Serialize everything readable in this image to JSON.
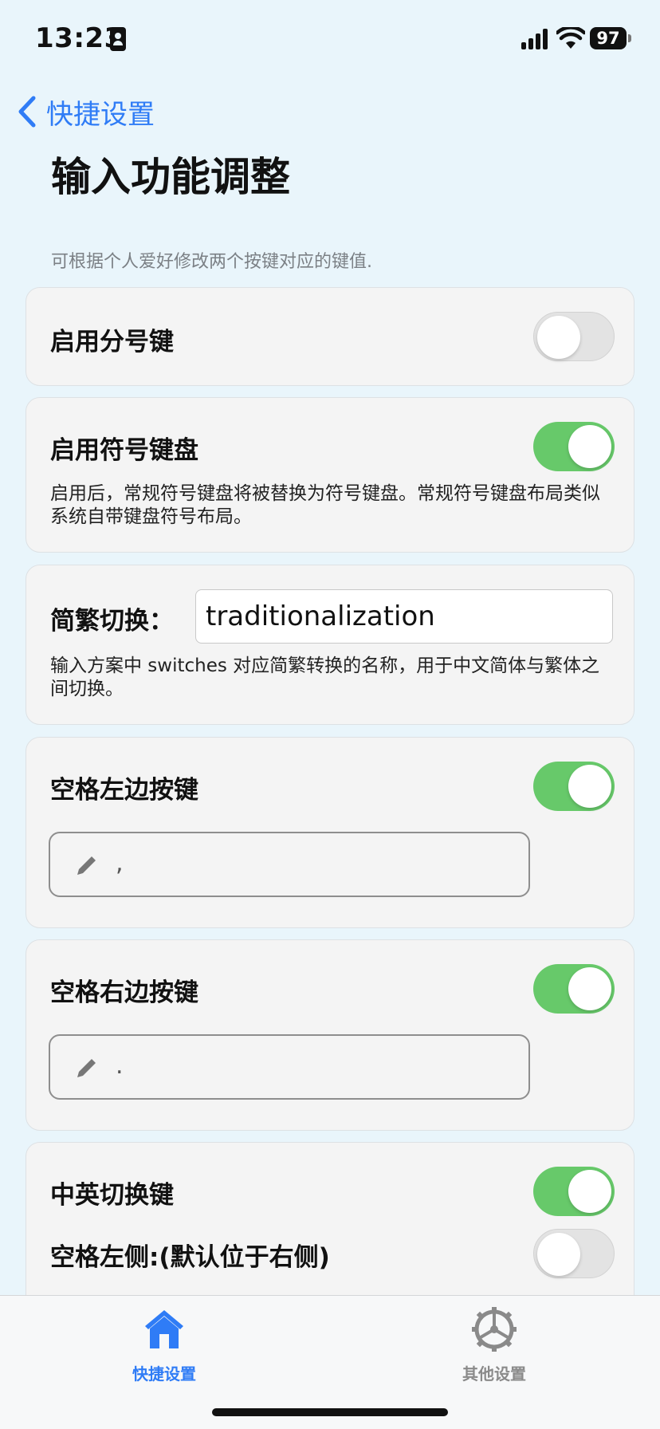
{
  "status_bar": {
    "time": "13:23",
    "battery": "97"
  },
  "nav": {
    "back_label": "快捷设置",
    "title": "输入功能调整"
  },
  "section_note": "可根据个人爱好修改两个按键对应的键值.",
  "settings": {
    "semicolon_key": {
      "label": "启用分号键",
      "enabled": false
    },
    "symbol_keyboard": {
      "label": "启用符号键盘",
      "enabled": true,
      "description": "启用后，常规符号键盘将被替换为符号键盘。常规符号键盘布局类似系统自带键盘符号布局。"
    },
    "simp_trad_switch": {
      "label": "简繁切换：",
      "value": "traditionalization",
      "description": "输入方案中 switches 对应简繁转换的名称，用于中文简体与繁体之间切换。"
    },
    "space_left_key": {
      "label": "空格左边按键",
      "enabled": true,
      "value": ","
    },
    "space_right_key": {
      "label": "空格右边按键",
      "enabled": true,
      "value": "."
    },
    "cn_en_switch_key": {
      "label": "中英切换键",
      "enabled": true,
      "position_label": "空格左侧:(默认位于右侧)",
      "position_left": false
    }
  },
  "tab_bar": {
    "tabs": [
      {
        "label": "快捷设置",
        "icon": "house-icon",
        "active": true
      },
      {
        "label": "其他设置",
        "icon": "gear-icon",
        "active": false
      }
    ]
  },
  "colors": {
    "accent": "#2f7cf6",
    "toggle_on": "#67c96a",
    "background": "#e9f5fb"
  }
}
